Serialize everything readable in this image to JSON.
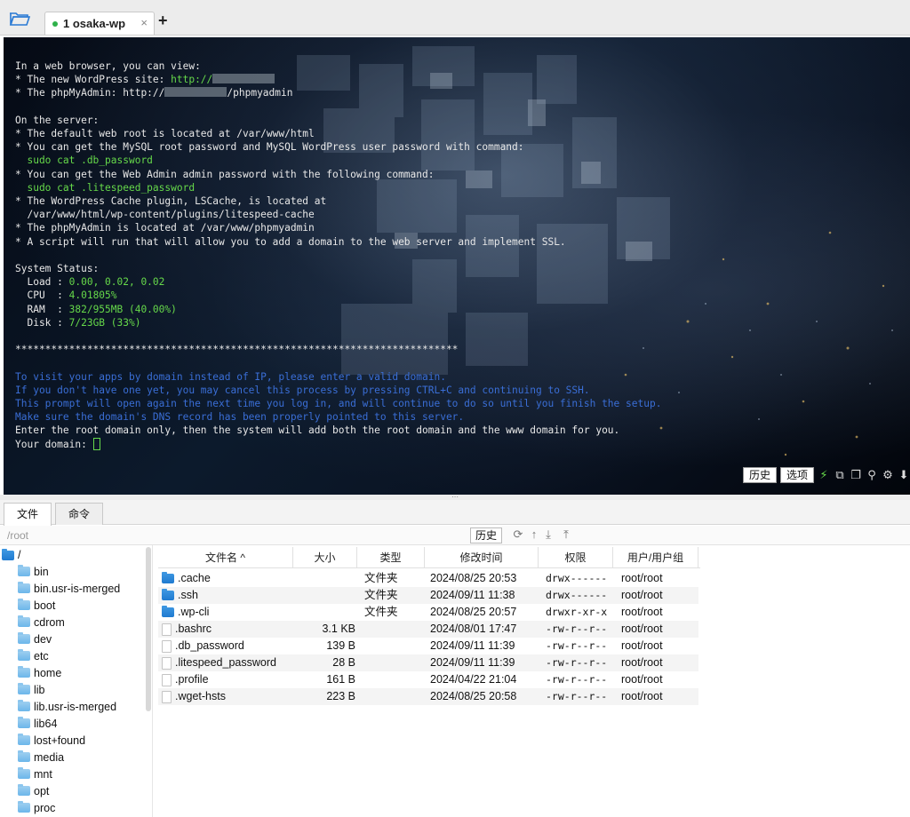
{
  "window": {
    "tab_label": "1 osaka-wp",
    "tab_close": "×",
    "add_tab": "+"
  },
  "terminal": {
    "lines": {
      "l1": "In a web browser, you can view:",
      "l2a": "* The new WordPress site: ",
      "l2b": "http://",
      "l3a": "* The phpMyAdmin: http://",
      "l3b": "/phpmyadmin",
      "l5": "On the server:",
      "l6": "* The default web root is located at /var/www/html",
      "l7": "* You can get the MySQL root password and MySQL WordPress user password with command:",
      "l8": "  sudo cat .db_password",
      "l9": "* You can get the Web Admin admin password with the following command:",
      "l10": "  sudo cat .litespeed_password",
      "l11": "* The WordPress Cache plugin, LSCache, is located at",
      "l12": "  /var/www/html/wp-content/plugins/litespeed-cache",
      "l13": "* The phpMyAdmin is located at /var/www/phpmyadmin",
      "l14": "* A script will run that will allow you to add a domain to the web server and implement SSL.",
      "l16": "System Status:",
      "load_k": "  Load : ",
      "load_v": "0.00, 0.02, 0.02",
      "cpu_k": "  CPU  : ",
      "cpu_v": "4.01805%",
      "ram_k": "  RAM  : ",
      "ram_v": "382/955MB (40.00%)",
      "disk_k": "  Disk : ",
      "disk_v": "7/23GB (33%)",
      "stars": "**************************************************************************",
      "b1": "To visit your apps by domain instead of IP, please enter a valid domain.",
      "b2": "If you don't have one yet, you may cancel this process by pressing CTRL+C and continuing to SSH.",
      "b3": "This prompt will open again the next time you log in, and will continue to do so until you finish the setup.",
      "b4": "Make sure the domain's DNS record has been properly pointed to this server.",
      "w1": "Enter the root domain only, then the system will add both the root domain and the www domain for you.",
      "w2": "Your domain: "
    },
    "history_button": "历史",
    "options_button": "选项"
  },
  "panel": {
    "tab_files": "文件",
    "tab_commands": "命令",
    "path": "/root",
    "history_button": "历史"
  },
  "tree": {
    "root": "/",
    "items": [
      "bin",
      "bin.usr-is-merged",
      "boot",
      "cdrom",
      "dev",
      "etc",
      "home",
      "lib",
      "lib.usr-is-merged",
      "lib64",
      "lost+found",
      "media",
      "mnt",
      "opt",
      "proc"
    ]
  },
  "files": {
    "headers": {
      "name": "文件名 ^",
      "size": "大小",
      "type": "类型",
      "mtime": "修改时间",
      "perm": "权限",
      "owner": "用户/用户组"
    },
    "rows": [
      {
        "name": ".cache",
        "size": "",
        "type": "文件夹",
        "mtime": "2024/08/25 20:53",
        "perm": "drwx------",
        "owner": "root/root",
        "folder": true
      },
      {
        "name": ".ssh",
        "size": "",
        "type": "文件夹",
        "mtime": "2024/09/11 11:38",
        "perm": "drwx------",
        "owner": "root/root",
        "folder": true
      },
      {
        "name": ".wp-cli",
        "size": "",
        "type": "文件夹",
        "mtime": "2024/08/25 20:57",
        "perm": "drwxr-xr-x",
        "owner": "root/root",
        "folder": true
      },
      {
        "name": ".bashrc",
        "size": "3.1 KB",
        "type": "",
        "mtime": "2024/08/01 17:47",
        "perm": "-rw-r--r--",
        "owner": "root/root",
        "folder": false
      },
      {
        "name": ".db_password",
        "size": "139 B",
        "type": "",
        "mtime": "2024/09/11 11:39",
        "perm": "-rw-r--r--",
        "owner": "root/root",
        "folder": false
      },
      {
        "name": ".litespeed_password",
        "size": "28 B",
        "type": "",
        "mtime": "2024/09/11 11:39",
        "perm": "-rw-r--r--",
        "owner": "root/root",
        "folder": false
      },
      {
        "name": ".profile",
        "size": "161 B",
        "type": "",
        "mtime": "2024/04/22 21:04",
        "perm": "-rw-r--r--",
        "owner": "root/root",
        "folder": false
      },
      {
        "name": ".wget-hsts",
        "size": "223 B",
        "type": "",
        "mtime": "2024/08/25 20:58",
        "perm": "-rw-r--r--",
        "owner": "root/root",
        "folder": false
      }
    ]
  },
  "icons": {
    "folder_open": "folder-open-icon",
    "lightning": "lightning-icon",
    "copy": "copy-icon",
    "paste": "paste-icon",
    "search": "search-icon",
    "gear": "gear-icon",
    "download": "download-icon",
    "refresh": "refresh-icon",
    "up": "up-arrow-icon",
    "upload": "upload-icon"
  },
  "colors": {
    "terminal_green": "#66d94a",
    "terminal_blue": "#3a6ed6",
    "folder_blue": "#3b95e0"
  }
}
